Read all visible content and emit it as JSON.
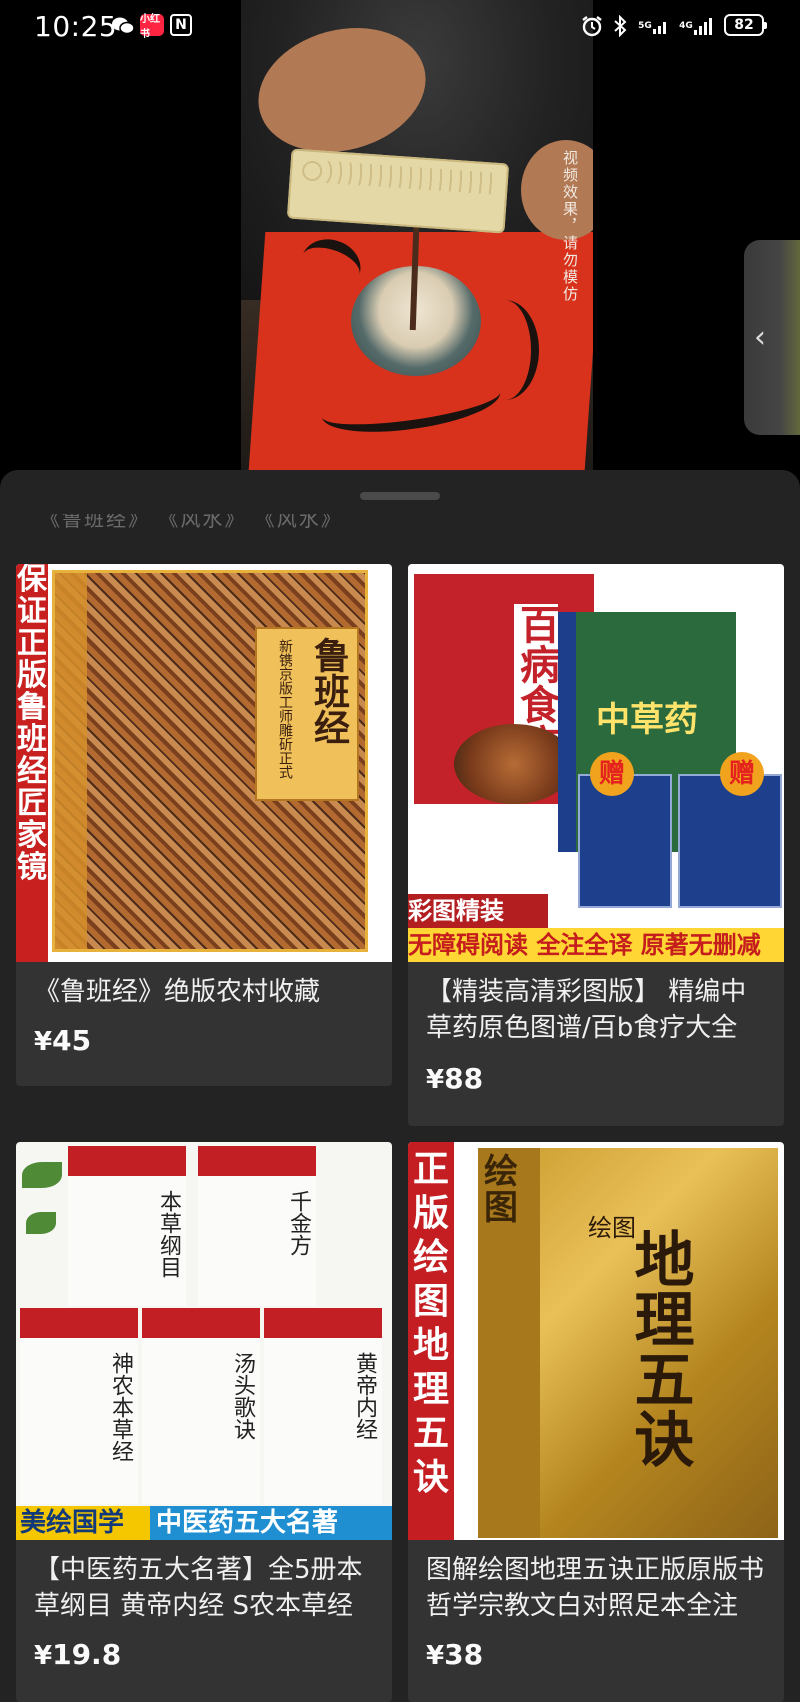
{
  "status_bar": {
    "time": "10:25",
    "xhs_badge": "小红书",
    "nfc": "N",
    "net1": "5G",
    "net2": "4G",
    "battery": "82"
  },
  "video": {
    "note": "视频效果，请勿模仿"
  },
  "side_pull": {
    "icon": "‹"
  },
  "sheet": {
    "ghost_text": "《鲁班经》 《风水》 《风水》"
  },
  "products": [
    {
      "title": "《鲁班经》绝版农村收藏",
      "currency": "¥",
      "price": "45",
      "art": {
        "band": "保证正版 鲁班经匠家镜",
        "book_title": "鲁班经",
        "book_sub": "新镌京版工师雕斫正式"
      }
    },
    {
      "title": "【精装高清彩图版】 精编中草药原色图谱/百b食疗大全",
      "currency": "¥",
      "price": "88",
      "art": {
        "book1": "百病食疗",
        "book2": "中草药",
        "gift": "赠",
        "strip1": "彩图精装",
        "strip2": "无障碍阅读 全注全译 原著无删减"
      }
    },
    {
      "title": "【中医药五大名著】全5册本草纲目 黄帝内经 S农本草经",
      "currency": "¥",
      "price": "19.8",
      "art": {
        "books": [
          "本草纲目",
          "千金方",
          "神农本草经",
          "汤头歌诀",
          "黄帝内经"
        ],
        "bar_a": "美绘国学",
        "bar_b": "中医药五大名著"
      }
    },
    {
      "title": "图解绘图地理五诀正版原版书哲学宗教文白对照足本全注",
      "currency": "¥",
      "price": "38",
      "art": {
        "band": "正版绘图地理五诀",
        "book_title": "地理五诀",
        "book_sub": "绘图"
      }
    }
  ]
}
